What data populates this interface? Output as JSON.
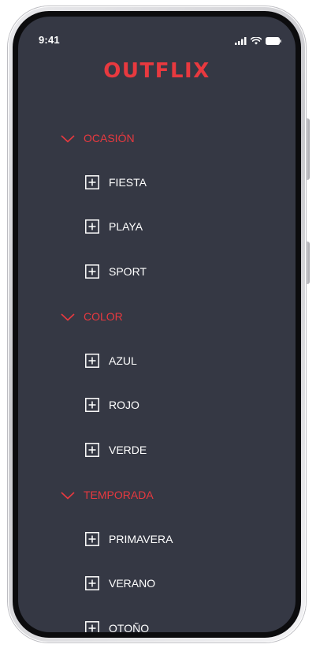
{
  "status_bar": {
    "time": "9:41",
    "icons": [
      "signal-icon",
      "wifi-icon",
      "battery-icon"
    ]
  },
  "app": {
    "logo": "OUTFLIX"
  },
  "colors": {
    "background": "#353844",
    "accent": "#e8393f",
    "text": "#ffffff"
  },
  "menu": {
    "categories": [
      {
        "label": "OCASIÓN",
        "expanded": true,
        "options": [
          {
            "label": "FIESTA"
          },
          {
            "label": "PLAYA"
          },
          {
            "label": "SPORT"
          }
        ]
      },
      {
        "label": "COLOR",
        "expanded": true,
        "options": [
          {
            "label": "AZUL"
          },
          {
            "label": "ROJO"
          },
          {
            "label": "VERDE"
          }
        ]
      },
      {
        "label": "TEMPORADA",
        "expanded": true,
        "options": [
          {
            "label": "PRIMAVERA"
          },
          {
            "label": "VERANO"
          },
          {
            "label": "OTOÑO"
          }
        ]
      }
    ]
  }
}
